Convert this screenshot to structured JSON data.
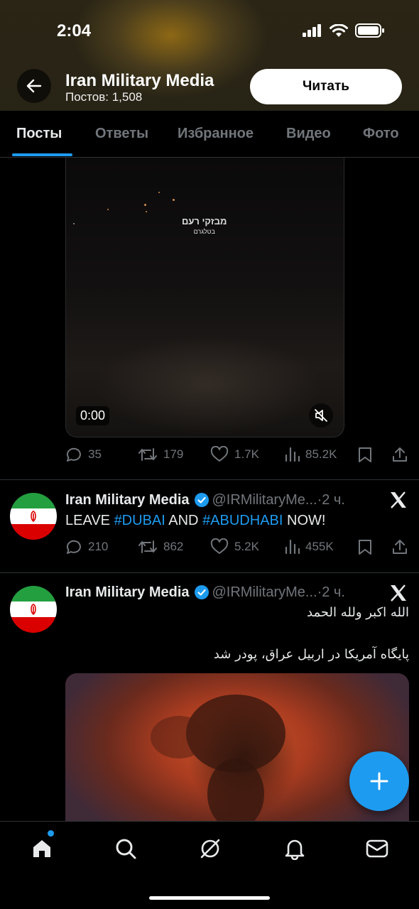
{
  "status_bar": {
    "time": "2:04"
  },
  "header": {
    "profile_name": "Iran Military Media",
    "posts_count": "Постов: 1,508",
    "read_button": "Читать"
  },
  "tabs": [
    {
      "label": "Посты",
      "active": true
    },
    {
      "label": "Ответы",
      "active": false
    },
    {
      "label": "Избранное",
      "active": false
    },
    {
      "label": "Видео",
      "active": false
    },
    {
      "label": "Фото",
      "active": false
    }
  ],
  "video_post": {
    "watermark_line1": "מבזקי רעם",
    "watermark_line2": "בטלגרם",
    "video_time": "0:00",
    "stats": {
      "replies": "35",
      "reposts": "179",
      "likes": "1.7K",
      "views": "85.2K"
    }
  },
  "tweet1": {
    "name": "Iran Military Media",
    "handle": "@IRMilitaryMe...",
    "time": "·2 ч.",
    "text_before": "LEAVE ",
    "hashtag1": "#DUBAI",
    "text_mid": " AND ",
    "hashtag2": "#ABUDHABI",
    "text_after": " NOW!",
    "stats": {
      "replies": "210",
      "reposts": "862",
      "likes": "5.2K",
      "views": "455K"
    }
  },
  "tweet2": {
    "name": "Iran Military Media",
    "handle": "@IRMilitaryMe...",
    "time": "·2 ч.",
    "line1": "الله اکبر ولله الحمد",
    "line2": "پایگاه آمریکا در اربیل عراق، پودر شد"
  },
  "colors": {
    "accent": "#1d9bf0",
    "muted": "#71767b",
    "text": "#e7e9ea",
    "flag_green": "#239f40",
    "flag_red": "#da0000"
  },
  "icons": [
    "back-arrow-icon",
    "signal-icon",
    "wifi-icon",
    "battery-icon",
    "mute-icon",
    "reply-icon",
    "repost-icon",
    "like-icon",
    "views-icon",
    "bookmark-icon",
    "share-icon",
    "verified-icon",
    "x-logo-icon",
    "plus-icon",
    "home-icon",
    "search-icon",
    "grok-icon",
    "notifications-icon",
    "messages-icon"
  ]
}
